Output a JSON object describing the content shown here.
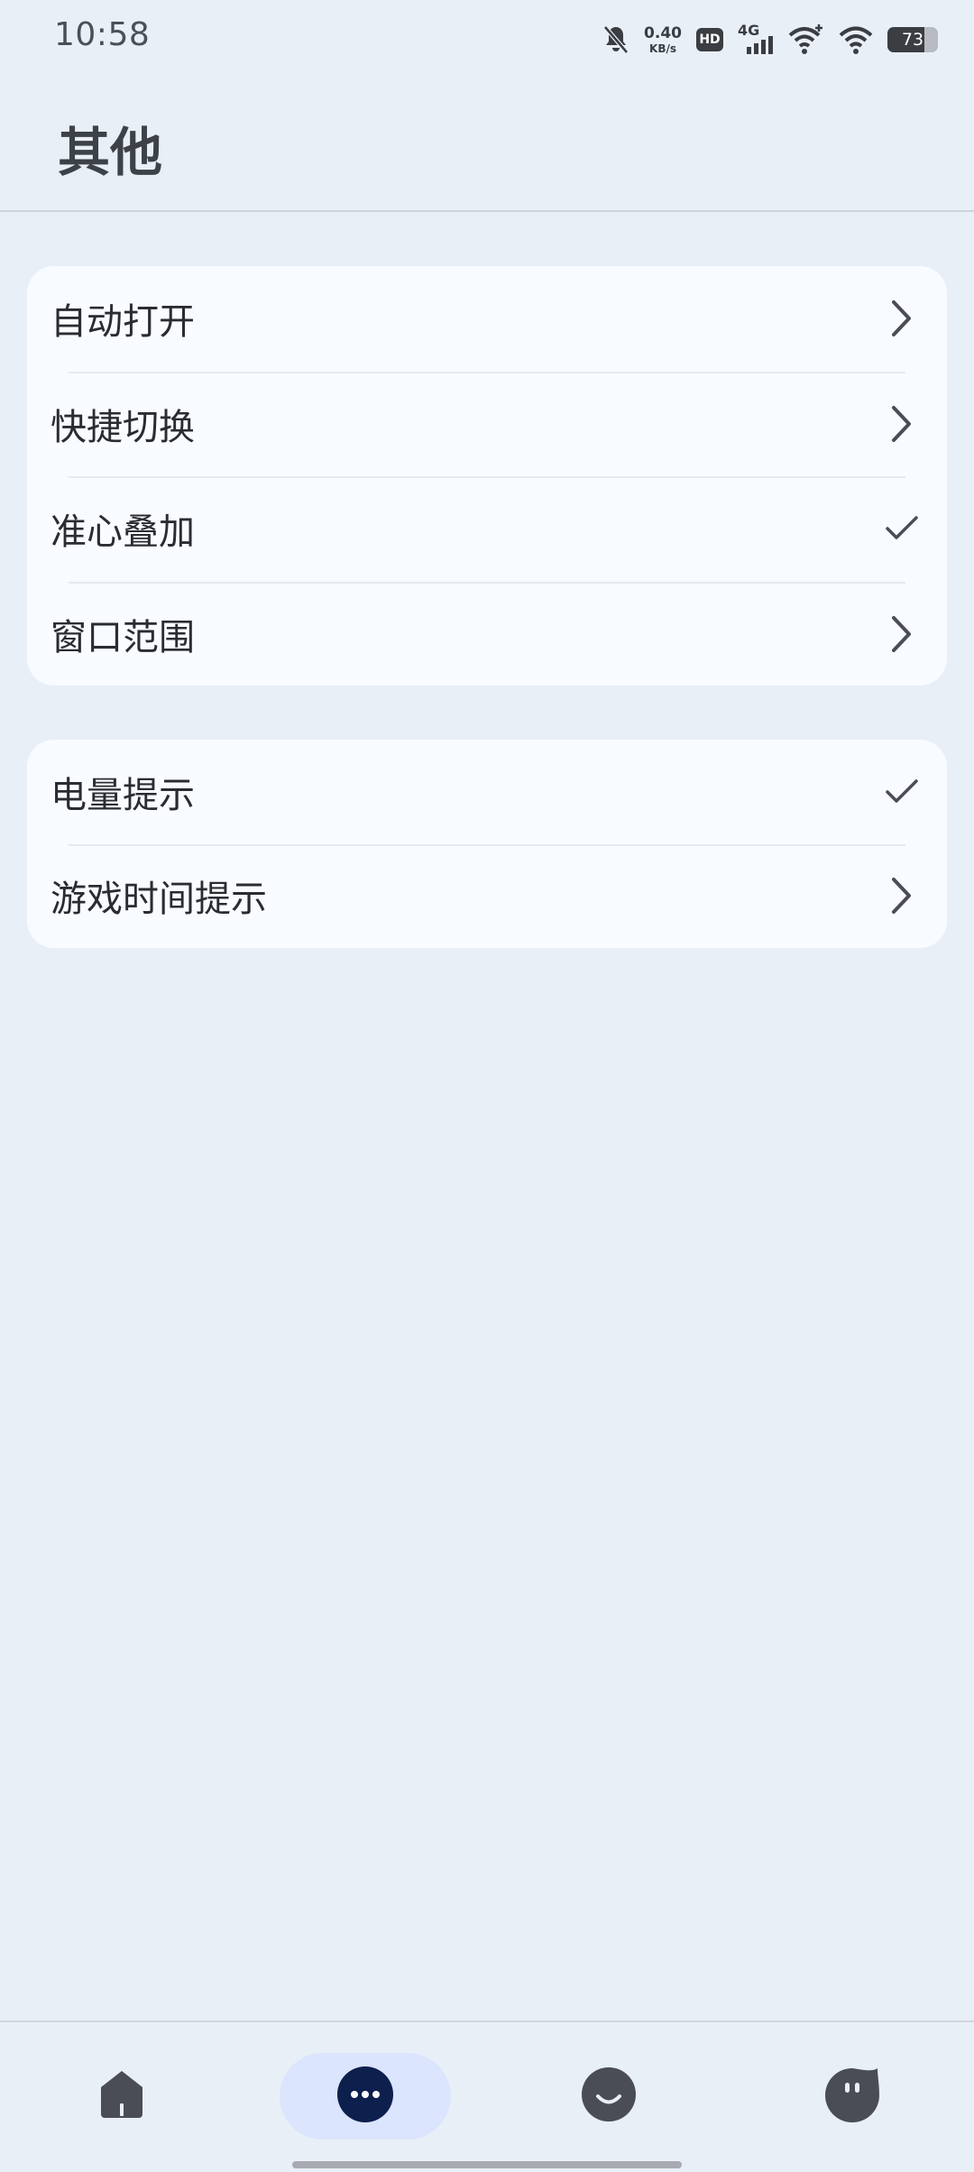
{
  "status_bar": {
    "time": "10:58",
    "net_speed_value": "0.40",
    "net_speed_unit": "KB/s",
    "hd_label": "HD",
    "network_label": "4G",
    "battery_level": "73",
    "icons": [
      "bell-off-icon",
      "hd-icon",
      "cellular-signal-icon",
      "wifi-plus-icon",
      "wifi-icon",
      "battery-icon"
    ]
  },
  "header": {
    "title": "其他"
  },
  "group1": {
    "items": [
      {
        "label": "自动打开",
        "trailing": "chevron-right-icon"
      },
      {
        "label": "快捷切换",
        "trailing": "chevron-right-icon"
      },
      {
        "label": "准心叠加",
        "trailing": "check-icon"
      },
      {
        "label": "窗口范围",
        "trailing": "chevron-right-icon"
      }
    ]
  },
  "group2": {
    "items": [
      {
        "label": "电量提示",
        "trailing": "check-icon"
      },
      {
        "label": "游戏时间提示",
        "trailing": "chevron-right-icon"
      }
    ]
  },
  "bottom_nav": {
    "items": [
      {
        "icon": "home-icon",
        "active": false
      },
      {
        "icon": "more-icon",
        "active": true
      },
      {
        "icon": "smile-icon",
        "active": false
      },
      {
        "icon": "chat-face-icon",
        "active": false
      }
    ]
  },
  "colors": {
    "background": "#e9eff6",
    "card": "#f8fbff",
    "text_primary": "#2a2c31",
    "icon": "#4a4d55",
    "nav_active_bg": "#dbe5fd",
    "nav_active_icon": "#0d1f4d"
  }
}
